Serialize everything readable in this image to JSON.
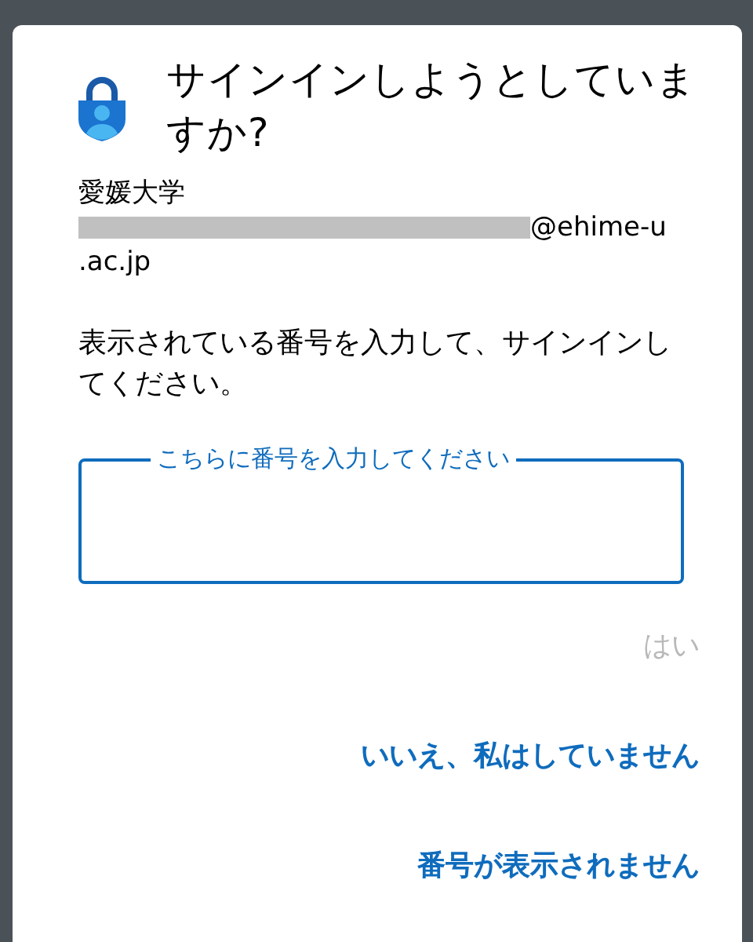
{
  "dialog": {
    "title": "サインインしようとしていますか?",
    "organization": "愛媛大学",
    "account": {
      "redacted": true,
      "lines": [
        "@ehime-u",
        ".ac.jp"
      ]
    },
    "instruction": "表示されている番号を入力して、サインインしてください。",
    "number_field": {
      "label": "こちらに番号を入力してください"
    },
    "actions": [
      {
        "label": "はい",
        "disabled": true
      },
      {
        "label": "いいえ、私はしていません",
        "disabled": false
      },
      {
        "label": "番号が表示されません",
        "disabled": false
      }
    ]
  }
}
